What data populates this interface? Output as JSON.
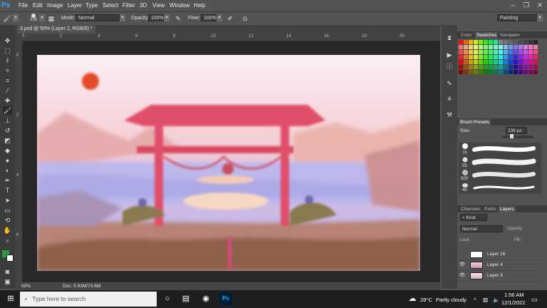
{
  "app": {
    "logo": "Ps",
    "menu": [
      "File",
      "Edit",
      "Image",
      "Layer",
      "Type",
      "Select",
      "Filter",
      "3D",
      "View",
      "Window",
      "Help"
    ],
    "window_controls": [
      "–",
      "❐",
      "✕"
    ]
  },
  "options": {
    "brush_size": "236",
    "mode_label": "Mode:",
    "mode_value": "Normal",
    "opacity_label": "Opacity:",
    "opacity_value": "100%",
    "flow_label": "Flow:",
    "flow_value": "100%",
    "workspace": "Painting"
  },
  "document": {
    "tab_title": "3.psd @ 50% (Layer 2, RGB/8) *",
    "ruler_top": [
      "0",
      "2",
      "4",
      "6",
      "8",
      "10",
      "12",
      "14",
      "16",
      "18",
      "20"
    ],
    "ruler_left": [
      "0",
      "2",
      "4",
      "6"
    ],
    "zoom": "50%",
    "doc_info": "Doc: 5.93M/73.6M"
  },
  "panels": {
    "color_tabs": [
      "Color",
      "Swatches",
      "Navigator"
    ],
    "brush_presets_title": "Brush Presets",
    "brush_size_label": "Size:",
    "brush_size_value": "236 px",
    "brush_sizes": [
      "70",
      "55",
      "500",
      "40"
    ],
    "layer_tabs": [
      "Channels",
      "Paths",
      "Layers"
    ],
    "kind_label": "Kind",
    "blend_mode": "Normal",
    "opacity_label": "Opacity:",
    "lock_label": "Lock:",
    "fill_label": "Fill:",
    "layers": [
      {
        "name": "Layer 16",
        "visible": false
      },
      {
        "name": "Layer 4",
        "visible": true
      },
      {
        "name": "Layer 3",
        "visible": true
      }
    ]
  },
  "taskbar": {
    "search_placeholder": "Type here to search",
    "weather_temp": "28°C",
    "weather_desc": "Partly cloudy",
    "time": "1:56 AM",
    "date": "12/1/2022"
  },
  "colors": {
    "ps_blue": "#31a8ff",
    "foreground": "#2b9a3a",
    "background": "#ffffff",
    "torii": "#e0506a"
  }
}
